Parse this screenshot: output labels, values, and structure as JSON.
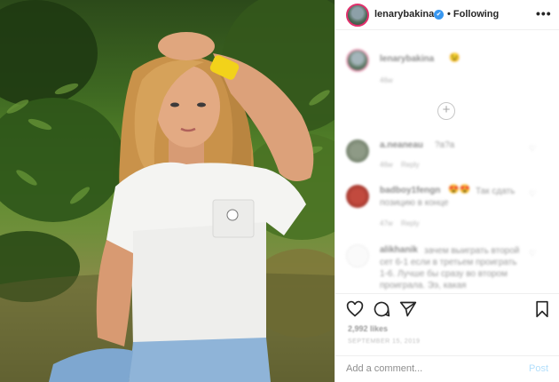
{
  "post": {
    "username": "lenarybakina",
    "verified_badge": "✔",
    "separator": "•",
    "follow_status": "Following",
    "more_glyph": "•••"
  },
  "caption": {
    "username": "lenarybakina",
    "emoji": "😉",
    "time": "46w"
  },
  "load_more_glyph": "+",
  "comments": [
    {
      "username": "a.neaneau",
      "text": "?a?a",
      "time": "46w",
      "reply_label": "Reply"
    },
    {
      "username": "badboy1fengn",
      "emoji": "😍😍",
      "text": "Так сдать позицию в конце",
      "time": "47w",
      "reply_label": "Reply"
    },
    {
      "username": "alikhanik",
      "text": "зачем выиграть второй сет 6-1 если в третьем проиграть 1-6. Лучше бы сразу во втором проиграла. Ээ, какая",
      "time": "",
      "reply_label": ""
    }
  ],
  "actions": {
    "like_icon": "heart-outline",
    "comment_icon": "speech-bubble",
    "share_icon": "paper-plane",
    "save_icon": "bookmark"
  },
  "likes_text": "2,992 likes",
  "date_text": "SEPTEMBER 15, 2019",
  "add_comment": {
    "placeholder": "Add a comment...",
    "post_label": "Post"
  },
  "colors": {
    "accent_blue": "#3897f0",
    "post_disabled": "#b2dffc",
    "story_ring": "#e1306c"
  }
}
